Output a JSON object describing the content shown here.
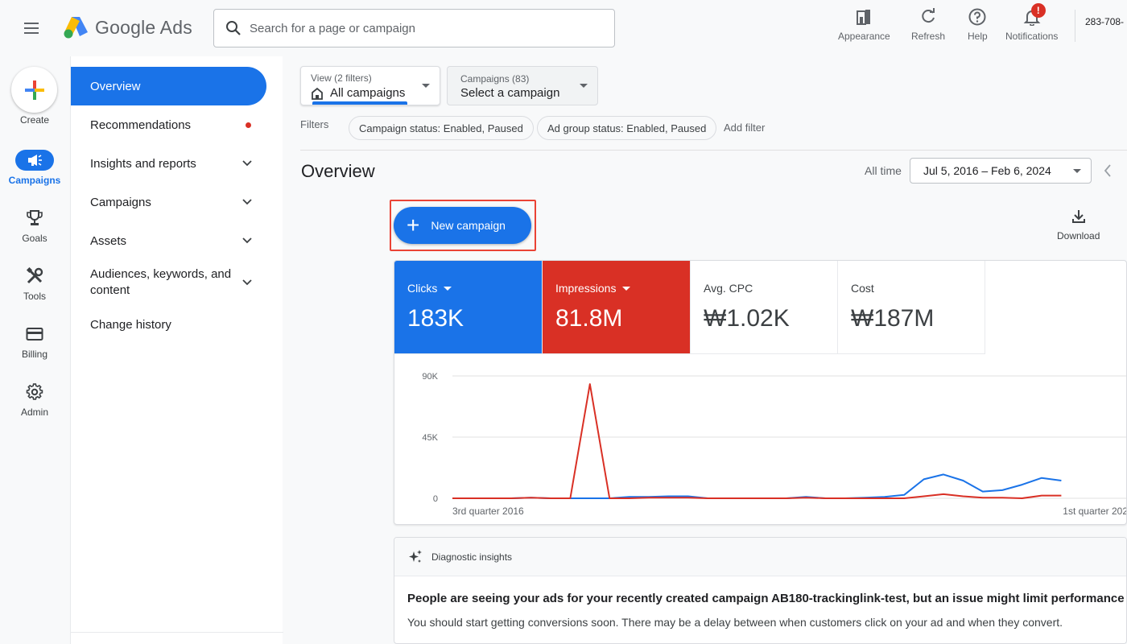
{
  "app": {
    "name": "Google Ads"
  },
  "search": {
    "placeholder": "Search for a page or campaign"
  },
  "top_actions": [
    {
      "label": "Appearance",
      "icon": "appearance-icon"
    },
    {
      "label": "Refresh",
      "icon": "refresh-icon"
    },
    {
      "label": "Help",
      "icon": "help-icon"
    },
    {
      "label": "Notifications",
      "icon": "bell-icon",
      "badge": "!"
    }
  ],
  "account_id": "283-708-",
  "rail": [
    {
      "label": "Create",
      "icon": "create-plus-icon"
    },
    {
      "label": "Campaigns",
      "icon": "megaphone-icon",
      "active": true
    },
    {
      "label": "Goals",
      "icon": "trophy-icon"
    },
    {
      "label": "Tools",
      "icon": "tools-icon"
    },
    {
      "label": "Billing",
      "icon": "credit-card-icon"
    },
    {
      "label": "Admin",
      "icon": "gear-icon"
    }
  ],
  "sidenav": [
    {
      "label": "Overview",
      "active": true
    },
    {
      "label": "Recommendations",
      "dot": true
    },
    {
      "label": "Insights and reports",
      "expandable": true
    },
    {
      "label": "Campaigns",
      "expandable": true
    },
    {
      "label": "Assets",
      "expandable": true
    },
    {
      "label": "Audiences, keywords, and content",
      "expandable": true
    },
    {
      "label": "Change history"
    }
  ],
  "view_dropdown": {
    "caption": "View (2 filters)",
    "value": "All campaigns"
  },
  "campaign_dropdown": {
    "caption": "Campaigns (83)",
    "value": "Select a campaign"
  },
  "filters": {
    "label": "Filters",
    "chips": [
      "Campaign status: Enabled, Paused",
      "Ad group status: Enabled, Paused"
    ],
    "add_label": "Add filter"
  },
  "page_title": "Overview",
  "date_range": {
    "label": "All time",
    "value": "Jul 5, 2016 – Feb 6, 2024"
  },
  "new_campaign": {
    "label": "New campaign"
  },
  "download": {
    "label": "Download"
  },
  "metrics": [
    {
      "label": "Clicks",
      "value": "183K",
      "color": "#1a73e8",
      "selectable": true
    },
    {
      "label": "Impressions",
      "value": "81.8M",
      "color": "#d93025",
      "selectable": true
    },
    {
      "label": "Avg. CPC",
      "value": "₩1.02K"
    },
    {
      "label": "Cost",
      "value": "₩187M"
    }
  ],
  "chart_data": {
    "type": "line",
    "y_ticks": [
      "90K",
      "45K",
      "0"
    ],
    "x_ticks": [
      "3rd quarter 2016",
      "1st quarter 202"
    ],
    "ylim": [
      0,
      90000
    ],
    "x": [
      0,
      1,
      2,
      3,
      4,
      5,
      6,
      7,
      8,
      9,
      10,
      11,
      12,
      13,
      14,
      15,
      16,
      17,
      18,
      19,
      20,
      21,
      22,
      23,
      24,
      25,
      26,
      27,
      28,
      29,
      30,
      31
    ],
    "series": [
      {
        "color": "#1a73e8",
        "values": [
          0,
          0,
          0,
          0,
          500,
          0,
          0,
          0,
          0,
          1000,
          1000,
          1500,
          1500,
          0,
          0,
          0,
          0,
          0,
          1000,
          0,
          0,
          500,
          1000,
          2500,
          14000,
          17500,
          13000,
          5000,
          6000,
          10000,
          15000,
          13000
        ]
      },
      {
        "color": "#d93025",
        "values": [
          0,
          0,
          0,
          0,
          500,
          0,
          0,
          84000,
          0,
          0,
          500,
          500,
          500,
          0,
          0,
          0,
          0,
          0,
          500,
          0,
          0,
          0,
          0,
          0,
          1500,
          3000,
          1500,
          500,
          500,
          0,
          2000,
          2000
        ]
      }
    ]
  },
  "diagnostic": {
    "header": "Diagnostic insights",
    "title": "People are seeing your ads for your recently created campaign AB180-trackinglink-test, but an issue might limit performance",
    "description": "You should start getting conversions soon. There may be a delay between when customers click on your ad and when they convert."
  }
}
